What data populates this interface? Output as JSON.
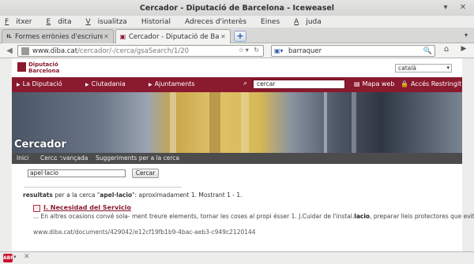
{
  "window": {
    "title": "Cercador - Diputació de Barcelona - Iceweasel",
    "minimize_glyph": "▾",
    "close_glyph": "✕"
  },
  "menubar": {
    "items": [
      {
        "first": "F",
        "rest": "itxer"
      },
      {
        "first": "E",
        "rest": "dita"
      },
      {
        "first": "V",
        "rest": "isualitza"
      },
      {
        "first": "",
        "rest": "Historial"
      },
      {
        "first": "",
        "rest": "Adreces d'interès"
      },
      {
        "first": "",
        "rest": "Eines"
      },
      {
        "first": "A",
        "rest": "juda"
      }
    ]
  },
  "tabs": [
    {
      "favicon": "IL",
      "title": "Formes errònies d'escriure l...",
      "close": "✕"
    },
    {
      "favicon": "▣",
      "title": "Cercador - Diputació de Barc...",
      "close": "✕"
    }
  ],
  "navbar": {
    "back_glyph": "◀",
    "url_domain": "www.diba.cat",
    "url_path": "/cercador/-/cerca/gsaSearch/1/20",
    "url_tools": "☆▾ ↻",
    "search_engine": "▣▾",
    "search_value": "barraquer",
    "search_go": "🔍",
    "home_glyph": "⌂",
    "menu_glyph": "▶"
  },
  "site": {
    "logo_line1": "Diputació",
    "logo_line2": "Barcelona",
    "language": "català",
    "nav": [
      "La Diputació",
      "Ciutadania",
      "Ajuntaments"
    ],
    "site_search_value": "cercar",
    "links": [
      "Mapa web",
      "Accés Restringit"
    ],
    "page_title": "Cercador",
    "subnav": [
      "Inici",
      "Cerca avançada",
      "Suggeriments per a la cerca"
    ],
    "query": "apel·lacio",
    "search_button": "Cercar"
  },
  "results": {
    "prefix": "resultats",
    "middle": "per a la cerca \"",
    "term": "apel·lacio",
    "suffix": "\": aproximadament 1. Mostrant 1 - 1.",
    "items": [
      {
        "title": "I. Necesidad del Servicio",
        "snippet_before": "... En altres ocasions convé sola- ment treure elements, tornar les coses al propi ésser 1. J.Cuidar de l'instal.",
        "snippet_bold": "lacio",
        "snippet_after": ", preparar lleis protectores que evitin ...",
        "url": "www.diba.cat/documents/429042/e12cf19fb1b9-4bac-aeb3-c949c2120144"
      }
    ]
  },
  "statusbar": {
    "abp_label": "ABP",
    "arrow": "▾",
    "close": "✕"
  }
}
